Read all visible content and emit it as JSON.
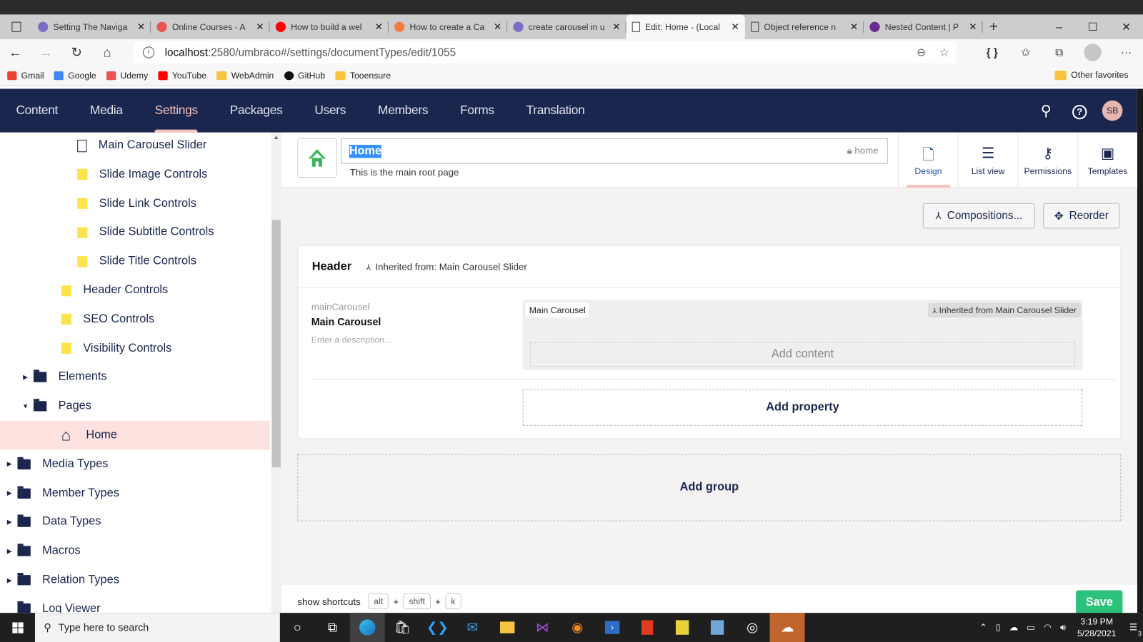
{
  "browser": {
    "tabs": [
      {
        "title": "Setting The Naviga",
        "favicon": "umbraco-circle",
        "color": "#7b6cc4"
      },
      {
        "title": "Online Courses - A",
        "favicon": "udemy",
        "color": "#ec5252"
      },
      {
        "title": "How to build a wel",
        "favicon": "youtube",
        "color": "#ff0000"
      },
      {
        "title": "How to create a Ca",
        "favicon": "share",
        "color": "#f47c3c"
      },
      {
        "title": "create carousel in u",
        "favicon": "umbraco-circle",
        "color": "#7b6cc4"
      },
      {
        "title": "Edit: Home - (Local",
        "favicon": "document",
        "color": "#ffffff",
        "active": true
      },
      {
        "title": "Object reference n",
        "favicon": "document",
        "color": "#cdcdcd"
      },
      {
        "title": "Nested Content | P",
        "favicon": "pn-logo",
        "color": "#6a2c91"
      }
    ],
    "new_tab": "+",
    "window_controls": {
      "minimize": "–",
      "maximize": "☐",
      "close": "✕"
    },
    "url_host": "localhost",
    "url_rest": ":2580/umbraco#/settings/documentTypes/edit/1055",
    "bookmarks": [
      {
        "label": "Gmail",
        "icon": "gmail",
        "color": "#ea4335"
      },
      {
        "label": "Google",
        "icon": "google",
        "color": "#4285f4"
      },
      {
        "label": "Udemy",
        "icon": "udemy",
        "color": "#ec5252"
      },
      {
        "label": "YouTube",
        "icon": "youtube",
        "color": "#ff0000"
      },
      {
        "label": "WebAdmin",
        "icon": "folder",
        "color": "#f5c542"
      },
      {
        "label": "GitHub",
        "icon": "github",
        "color": "#111111"
      },
      {
        "label": "Tooensure",
        "icon": "folder",
        "color": "#f5c542"
      }
    ],
    "other_favorites": "Other favorites"
  },
  "app": {
    "sections": [
      "Content",
      "Media",
      "Settings",
      "Packages",
      "Users",
      "Members",
      "Forms",
      "Translation"
    ],
    "active_section": "Settings",
    "avatar_initials": "SB"
  },
  "tree": [
    {
      "label": "Main Carousel Slider",
      "icon": "document",
      "level": 3
    },
    {
      "label": "Slide Image Controls",
      "icon": "yellow-folder",
      "level": 3
    },
    {
      "label": "Slide Link Controls",
      "icon": "yellow-folder",
      "level": 3
    },
    {
      "label": "Slide Subtitle Controls",
      "icon": "yellow-folder",
      "level": 3
    },
    {
      "label": "Slide Title Controls",
      "icon": "yellow-folder",
      "level": 3
    },
    {
      "label": "Header Controls",
      "icon": "yellow-folder",
      "level": 2
    },
    {
      "label": "SEO Controls",
      "icon": "yellow-folder",
      "level": 2
    },
    {
      "label": "Visibility Controls",
      "icon": "yellow-folder",
      "level": 2
    },
    {
      "label": "Elements",
      "icon": "folder",
      "level": 1,
      "caret": "right"
    },
    {
      "label": "Pages",
      "icon": "folder",
      "level": 1,
      "caret": "down"
    },
    {
      "label": "Home",
      "icon": "home",
      "level": 2,
      "selected": true
    },
    {
      "label": "Media Types",
      "icon": "folder",
      "level": 0,
      "caret": "right"
    },
    {
      "label": "Member Types",
      "icon": "folder",
      "level": 0,
      "caret": "right"
    },
    {
      "label": "Data Types",
      "icon": "folder",
      "level": 0,
      "caret": "right"
    },
    {
      "label": "Macros",
      "icon": "folder",
      "level": 0,
      "caret": "right"
    },
    {
      "label": "Relation Types",
      "icon": "folder",
      "level": 0,
      "caret": "right"
    },
    {
      "label": "Log Viewer",
      "icon": "archive",
      "level": 0
    }
  ],
  "editor": {
    "name": "Home",
    "alias": "home",
    "description": "This is the main root page",
    "apps": [
      {
        "label": "Design",
        "icon": "document-dashed",
        "active": true
      },
      {
        "label": "List view",
        "icon": "list"
      },
      {
        "label": "Permissions",
        "icon": "keys"
      },
      {
        "label": "Templates",
        "icon": "layout"
      }
    ],
    "compositions_label": "Compositions...",
    "reorder_label": "Reorder",
    "group": {
      "title": "Header",
      "inherited_prefix": "Inherited from:",
      "inherited_from": "Main Carousel Slider",
      "property": {
        "alias": "mainCarousel",
        "name": "Main Carousel",
        "description_placeholder": "Enter a description...",
        "preview_label": "Main Carousel",
        "preview_inherited": "Inherited from Main Carousel Slider",
        "add_content": "Add content"
      },
      "add_property": "Add property"
    },
    "add_group": "Add group"
  },
  "footer": {
    "shortcuts_label": "show shortcuts",
    "keys": [
      "alt",
      "shift",
      "k"
    ],
    "plus": "+",
    "save_label": "Save"
  },
  "taskbar": {
    "search_placeholder": "Type here to search",
    "time": "3:19 PM",
    "date": "5/28/2021",
    "notification_count": "3"
  }
}
